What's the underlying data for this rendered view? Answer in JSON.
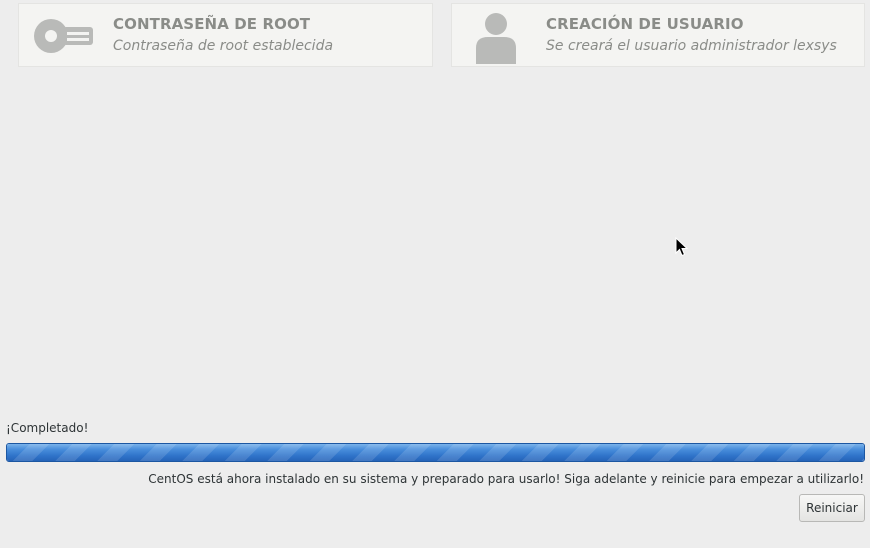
{
  "spokes": {
    "root_password": {
      "title": "CONTRASEÑA DE ROOT",
      "status": "Contraseña de root establecida",
      "icon": "key-icon"
    },
    "user_creation": {
      "title": "CREACIÓN DE USUARIO",
      "status": "Se creará el usuario administrador lexsys",
      "icon": "user-icon"
    }
  },
  "progress": {
    "label": "¡Completado!",
    "value": 1.0,
    "color": "#3a7bd5",
    "message": "CentOS está ahora instalado en su sistema y preparado para usarlo! Siga adelante y reinicie para empezar a utilizarlo!"
  },
  "actions": {
    "reboot_label": "Reiniciar"
  },
  "colors": {
    "background": "#ededed",
    "spoke_text": "#8a8c88",
    "progress_fill": "#2f73c9"
  }
}
